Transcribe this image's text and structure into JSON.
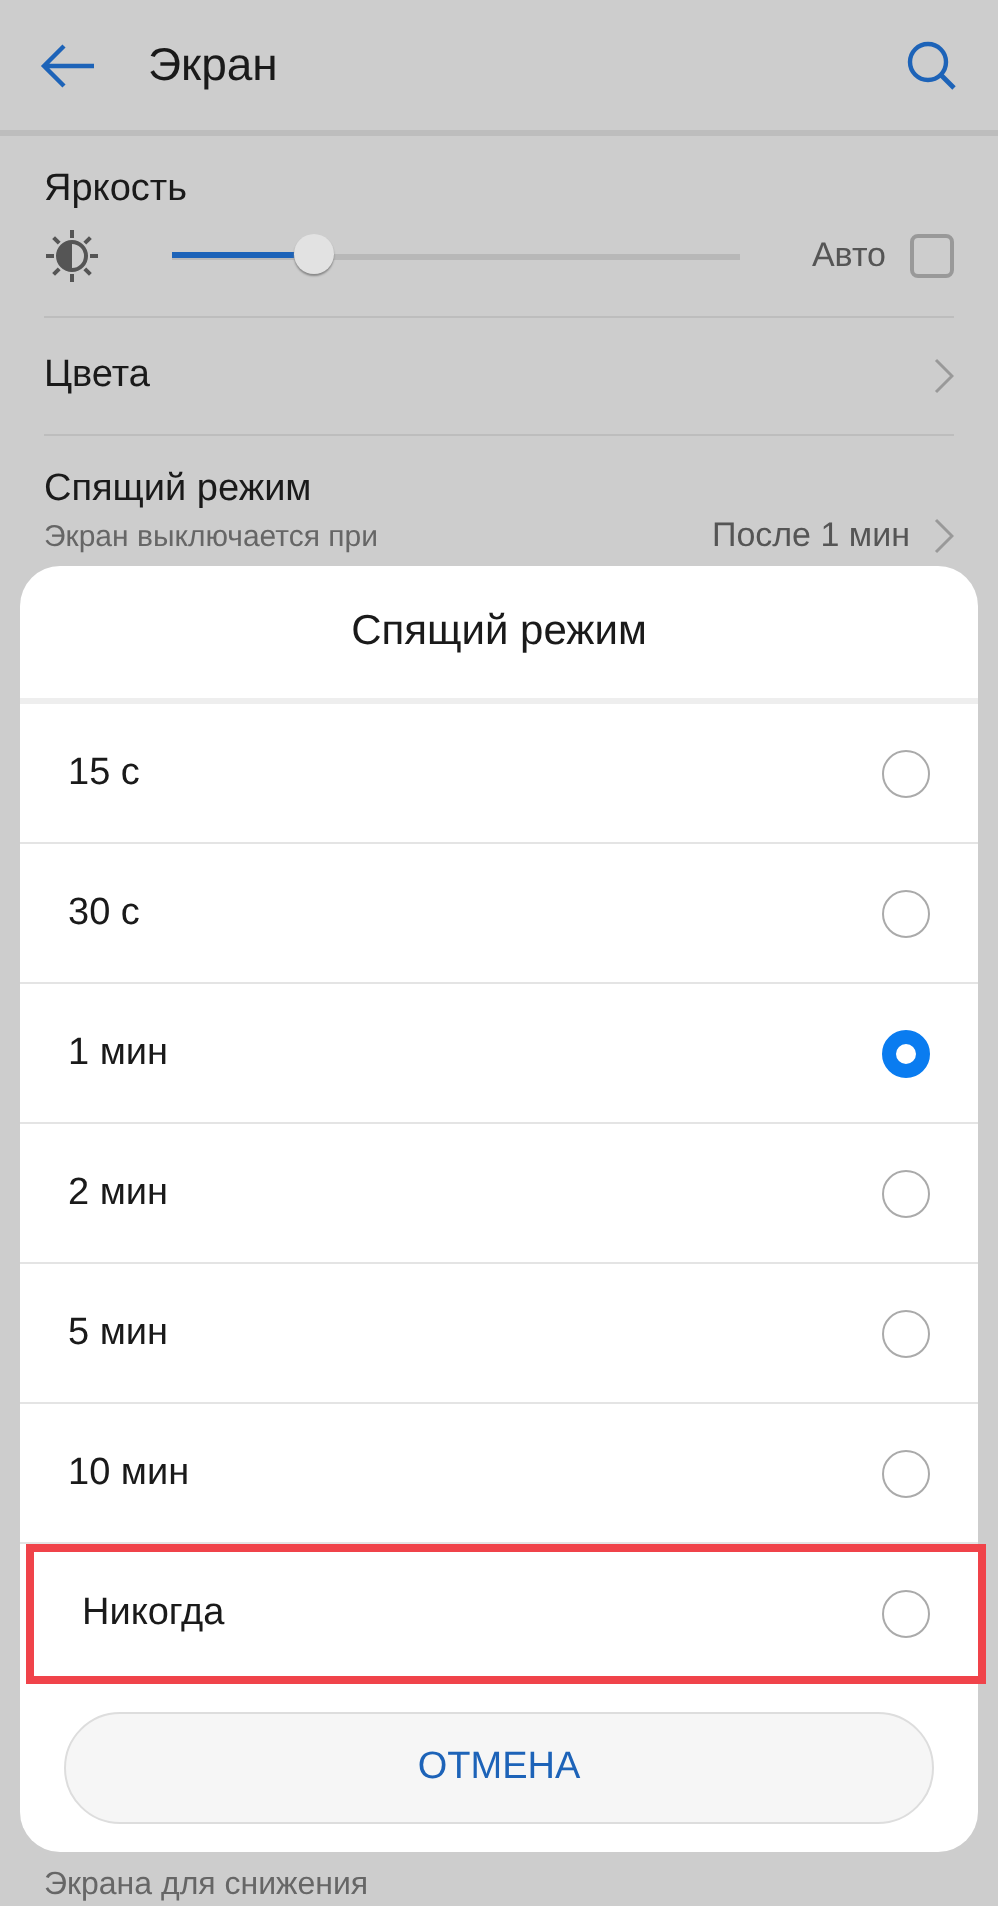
{
  "header": {
    "title": "Экран"
  },
  "brightness": {
    "label": "Яркость",
    "level": 0.25,
    "auto_label": "Авто",
    "auto_checked": false
  },
  "colors": {
    "label": "Цвета"
  },
  "sleep": {
    "label": "Спящий режим",
    "subtitle": "Экран выключается при",
    "value": "После 1 мин"
  },
  "bottom_text": "Экрана для снижения",
  "dialog": {
    "title": "Спящий режим",
    "options": [
      {
        "label": "15 с",
        "selected": false,
        "highlighted": false
      },
      {
        "label": "30 с",
        "selected": false,
        "highlighted": false
      },
      {
        "label": "1 мин",
        "selected": true,
        "highlighted": false
      },
      {
        "label": "2 мин",
        "selected": false,
        "highlighted": false
      },
      {
        "label": "5 мин",
        "selected": false,
        "highlighted": false
      },
      {
        "label": "10 мин",
        "selected": false,
        "highlighted": false
      },
      {
        "label": "Никогда",
        "selected": false,
        "highlighted": true
      }
    ],
    "cancel": "ОТМЕНА"
  }
}
